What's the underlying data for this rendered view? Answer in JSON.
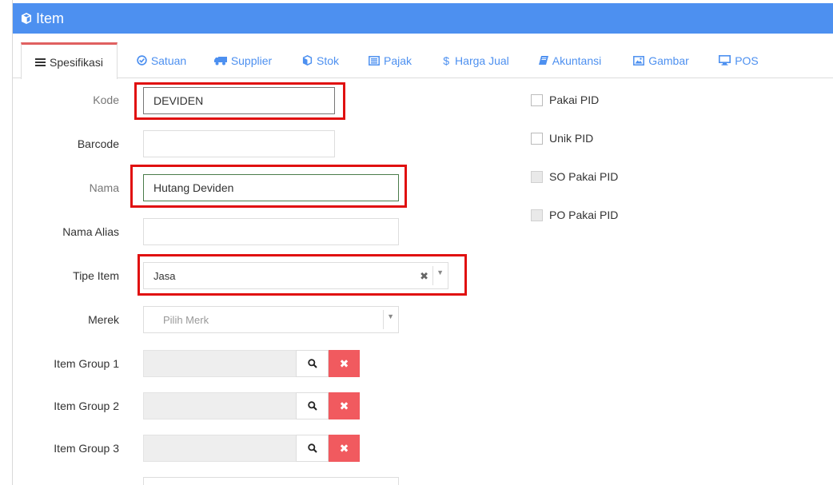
{
  "panel": {
    "title": "Item",
    "title_icon": "cube-icon",
    "accent_color": "#4d90f0"
  },
  "tabs": [
    {
      "label": "Spesifikasi",
      "icon": "list-icon",
      "active": true
    },
    {
      "label": "Satuan",
      "icon": "check-circle-icon"
    },
    {
      "label": "Supplier",
      "icon": "truck-icon"
    },
    {
      "label": "Stok",
      "icon": "cube-icon"
    },
    {
      "label": "Pajak",
      "icon": "list-alt-icon"
    },
    {
      "label": "Harga Jual",
      "icon": "dollar-icon"
    },
    {
      "label": "Akuntansi",
      "icon": "book-icon"
    },
    {
      "label": "Gambar",
      "icon": "picture-icon"
    },
    {
      "label": "POS",
      "icon": "monitor-icon"
    }
  ],
  "form": {
    "kode": {
      "label": "Kode",
      "value": "DEVIDEN"
    },
    "barcode": {
      "label": "Barcode",
      "value": ""
    },
    "nama": {
      "label": "Nama",
      "value": "Hutang Deviden"
    },
    "nama_alias": {
      "label": "Nama Alias",
      "value": ""
    },
    "tipe_item": {
      "label": "Tipe Item",
      "value": "Jasa"
    },
    "merek": {
      "label": "Merek",
      "placeholder": "Pilih Merk"
    },
    "item_group_1": {
      "label": "Item Group 1",
      "value": ""
    },
    "item_group_2": {
      "label": "Item Group 2",
      "value": ""
    },
    "item_group_3": {
      "label": "Item Group 3",
      "value": ""
    }
  },
  "checkboxes": [
    {
      "label": "Pakai PID",
      "checked": false,
      "disabled": false
    },
    {
      "label": "Unik PID",
      "checked": false,
      "disabled": false
    },
    {
      "label": "SO Pakai PID",
      "checked": false,
      "disabled": true
    },
    {
      "label": "PO Pakai PID",
      "checked": false,
      "disabled": true
    }
  ],
  "colors": {
    "highlight": "#e01010",
    "clear_button": "#f15a5f",
    "active_tab_border": "#e06060"
  }
}
